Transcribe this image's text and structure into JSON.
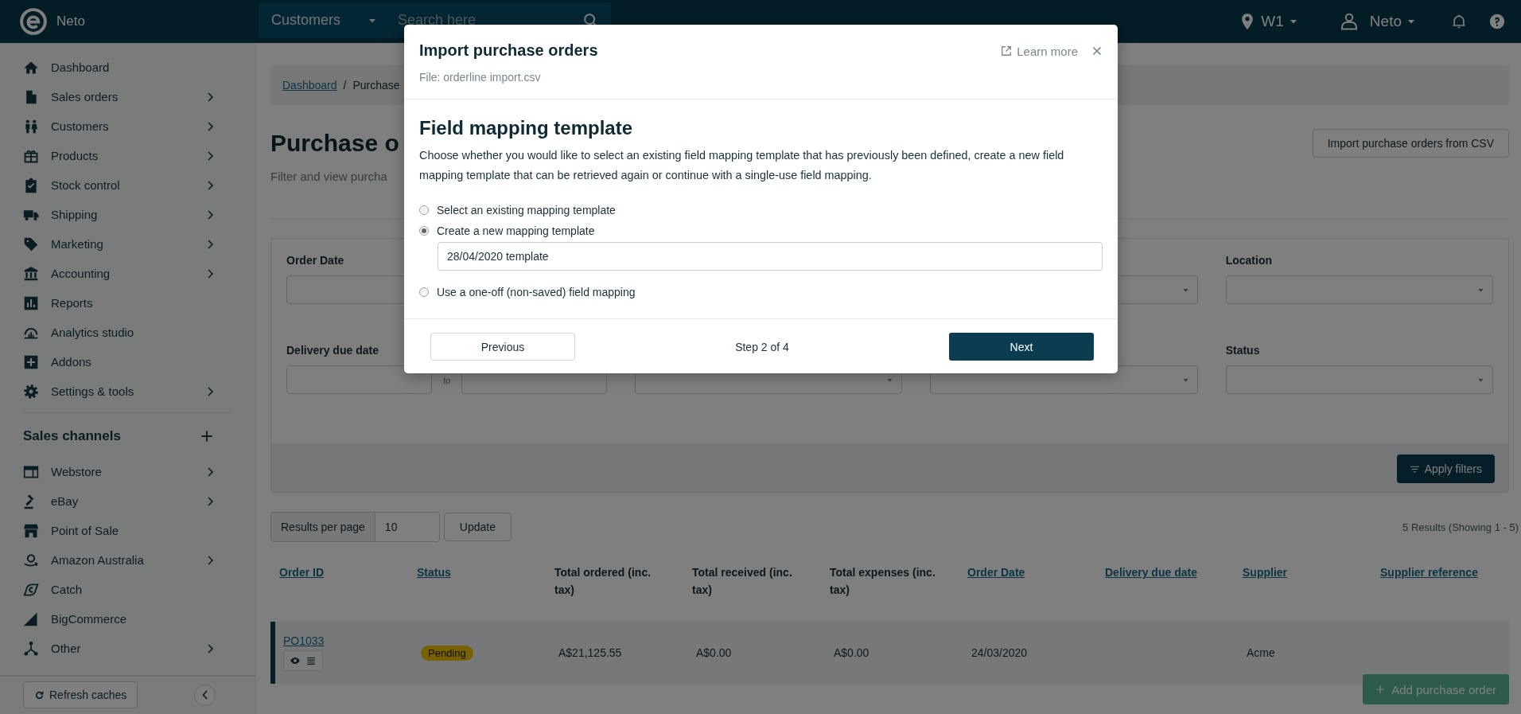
{
  "topbar": {
    "brand": "Neto",
    "search_scope": "Customers",
    "search": {
      "placeholder": "Search here"
    },
    "location": "W1",
    "user": "Neto"
  },
  "sidebar": {
    "items": [
      {
        "label": "Dashboard",
        "has_submenu": false
      },
      {
        "label": "Sales orders",
        "has_submenu": true
      },
      {
        "label": "Customers",
        "has_submenu": true
      },
      {
        "label": "Products",
        "has_submenu": true
      },
      {
        "label": "Stock control",
        "has_submenu": true
      },
      {
        "label": "Shipping",
        "has_submenu": true
      },
      {
        "label": "Marketing",
        "has_submenu": true
      },
      {
        "label": "Accounting",
        "has_submenu": true
      },
      {
        "label": "Reports",
        "has_submenu": false
      },
      {
        "label": "Analytics studio",
        "has_submenu": false
      },
      {
        "label": "Addons",
        "has_submenu": false
      },
      {
        "label": "Settings & tools",
        "has_submenu": true
      }
    ],
    "channels_heading": "Sales channels",
    "channels": [
      {
        "label": "Webstore",
        "has_submenu": true
      },
      {
        "label": "eBay",
        "has_submenu": true
      },
      {
        "label": "Point of Sale",
        "has_submenu": false
      },
      {
        "label": "Amazon Australia",
        "has_submenu": true
      },
      {
        "label": "Catch",
        "has_submenu": false
      },
      {
        "label": "BigCommerce",
        "has_submenu": false
      },
      {
        "label": "Other",
        "has_submenu": true
      }
    ],
    "refresh_button": "Refresh caches"
  },
  "page": {
    "breadcrumb": {
      "items": [
        {
          "label": "Dashboard",
          "link": true
        },
        {
          "label": "Purchase",
          "link": false
        }
      ],
      "separator": "/"
    },
    "title": "Purchase o",
    "subtitle": "Filter and view purcha",
    "import_button": "Import purchase orders from CSV",
    "filters": {
      "rows": [
        [
          {
            "kind": "date_range",
            "label": "Order Date"
          },
          {
            "kind": "select"
          },
          {
            "kind": "select",
            "label": "Location"
          }
        ],
        [
          {
            "kind": "date_range",
            "label": "Delivery due date",
            "separator": "to"
          },
          {
            "kind": "select"
          },
          {
            "kind": "select"
          },
          {
            "kind": "select",
            "label": "Status"
          }
        ]
      ],
      "apply_button": "Apply filters"
    },
    "results_per_page": {
      "label": "Results per page",
      "value": "10",
      "button": "Update"
    },
    "results_summary": "5 Results (Showing 1 - 5)",
    "table": {
      "columns": [
        {
          "label": "Order ID",
          "sortable": true
        },
        {
          "label": "Status",
          "sortable": true
        },
        {
          "label": "Total ordered (inc. tax)",
          "sortable": false
        },
        {
          "label": "Total received (inc. tax)",
          "sortable": false
        },
        {
          "label": "Total expenses (inc. tax)",
          "sortable": false
        },
        {
          "label": "Order Date",
          "sortable": true
        },
        {
          "label": "Delivery due date",
          "sortable": true
        },
        {
          "label": "Supplier",
          "sortable": true
        },
        {
          "label": "Supplier reference",
          "sortable": true
        }
      ],
      "rows": [
        {
          "order_id": "PO1033",
          "status": "Pending",
          "total_ordered": "A$21,125.55",
          "total_received": "A$0.00",
          "total_expenses": "A$0.00",
          "order_date": "24/03/2020",
          "supplier": "Acme"
        }
      ]
    },
    "add_button": "Add purchase order"
  },
  "modal": {
    "title": "Import purchase orders",
    "file": "File: orderline import.csv",
    "learn_more": "Learn more",
    "heading": "Field mapping template",
    "description": "Choose whether you would like to select an existing field mapping template that has previously been defined, create a new field mapping template that can be retrieved again or continue with a single-use field mapping.",
    "options": [
      {
        "label": "Select an existing mapping template",
        "selected": false
      },
      {
        "label": "Create a new mapping template",
        "selected": true,
        "input_value": "28/04/2020 template"
      },
      {
        "label": "Use a one-off (non-saved) field mapping",
        "selected": false
      }
    ],
    "previous_button": "Previous",
    "step": "Step 2 of 4",
    "next_button": "Next"
  }
}
